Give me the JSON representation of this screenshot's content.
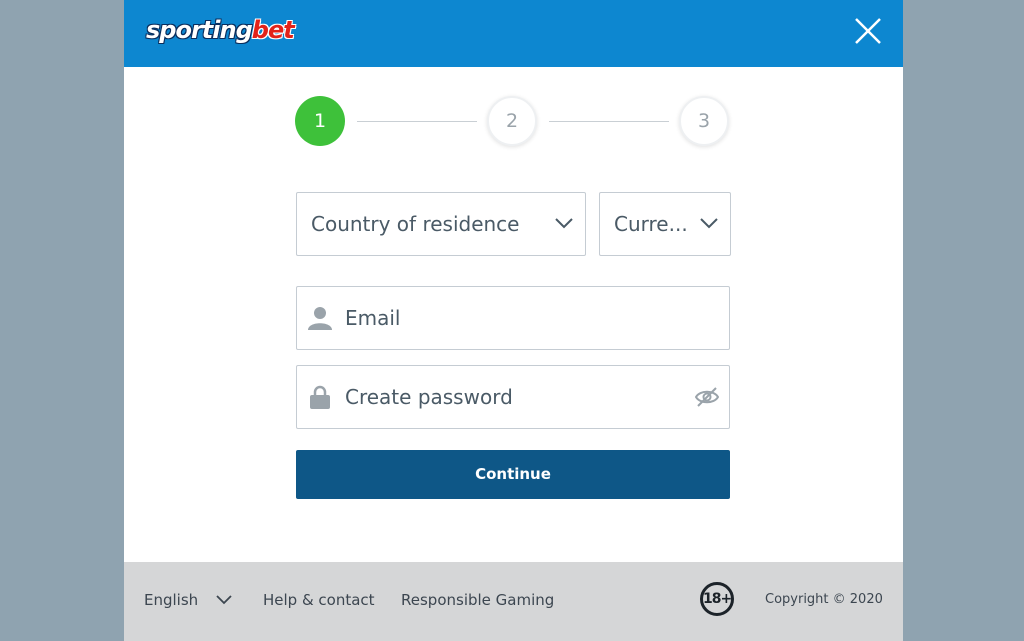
{
  "header": {
    "logo_part1": "sporting",
    "logo_part2": "bet",
    "brand_color": "#0d87d0",
    "close_icon": "close-icon"
  },
  "stepper": {
    "steps": [
      {
        "label": "1",
        "state": "active"
      },
      {
        "label": "2",
        "state": "inactive"
      },
      {
        "label": "3",
        "state": "inactive"
      }
    ],
    "active_color": "#3ec13a"
  },
  "form": {
    "country_placeholder": "Country of residence",
    "currency_placeholder": "Curre...",
    "email_placeholder": "Email",
    "password_placeholder": "Create password",
    "continue_label": "Continue",
    "button_color": "#0e5787"
  },
  "footer": {
    "language": "English",
    "help": "Help & contact",
    "responsible": "Responsible Gaming",
    "age_badge": "18+",
    "copyright": "Copyright © 2020"
  }
}
